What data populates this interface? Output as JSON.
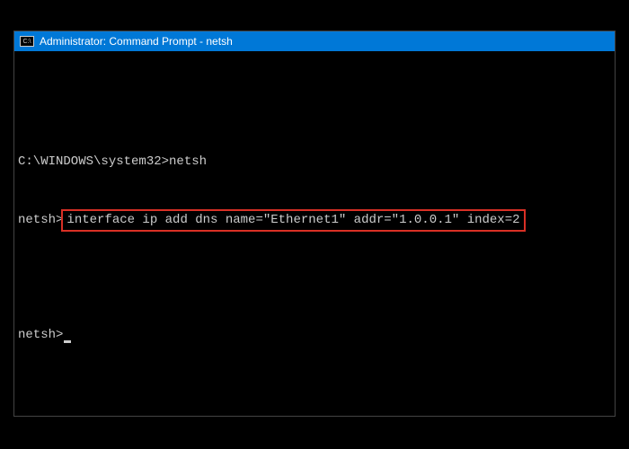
{
  "window": {
    "icon_label": "C:\\",
    "title": "Administrator: Command Prompt - netsh"
  },
  "terminal": {
    "line1_prompt": "C:\\WINDOWS\\system32>",
    "line1_cmd": "netsh",
    "line2_prompt": "netsh>",
    "line2_cmd": "interface ip add dns name=\"Ethernet1\" addr=\"1.0.0.1\" index=2",
    "line3_prompt": "netsh>"
  }
}
